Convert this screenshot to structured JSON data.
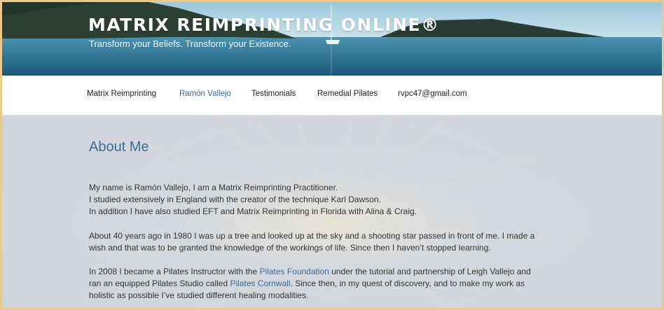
{
  "header": {
    "site_title": "MATRIX REIMPRINTING ONLINE®",
    "tagline": "Transform your Beliefs. Transform your Existence."
  },
  "nav": {
    "items": [
      {
        "label": "Matrix Reimprinting",
        "active": false
      },
      {
        "label": "Ramón Vallejo",
        "active": true
      },
      {
        "label": "Testimonials",
        "active": false
      },
      {
        "label": "Remedial Pilates",
        "active": false
      },
      {
        "label": "rvpc47@gmail.com",
        "active": false
      }
    ]
  },
  "page": {
    "title": "About Me",
    "paragraph1": {
      "line1": "My name is Ramón Vallejo, I am a Matrix Reimprinting Practitioner.",
      "line2": "I studied extensively in England with the creator of the technique Karl Dawson.",
      "line3": "In addition I have also studied EFT and Matrix Reimprinting in Florida with Alina & Craig."
    },
    "paragraph2": {
      "line1": "About 40 years ago in 1980 I was up a tree and looked up at the sky and a shooting star passed in front of me. I made a",
      "line2": "wish and that was to be granted the knowledge of the workings of life. Since then I haven’t stopped learning."
    },
    "paragraph3": {
      "line1_before": "In 2008 I became a Pilates Instructor with the ",
      "link1": "Pilates Foundation",
      "line1_after": " under the tutorial and partnership of Leigh Vallejo and",
      "line2_before": "ran an equipped Pilates Studio called ",
      "link2": "Pilates Cornwall",
      "line2_after": ". Since then, in my quest of discovery, and to make my work as",
      "line3": "holistic as possible I’ve studied different healing modalities."
    }
  },
  "colors": {
    "frame": "#e8c98f",
    "link": "#3a6a94",
    "title": "#3b6e96",
    "text": "#333333"
  }
}
